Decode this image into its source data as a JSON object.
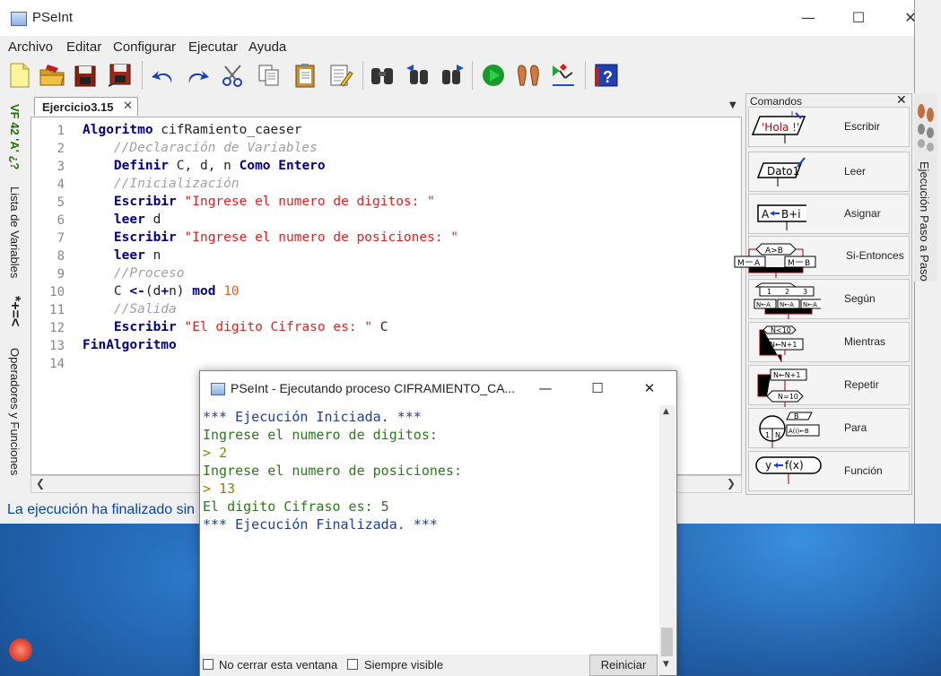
{
  "main_window": {
    "title": "PSeInt",
    "controls": {
      "minimize": "—",
      "maximize": "☐",
      "close": "✕"
    }
  },
  "menu": [
    "Archivo",
    "Editar",
    "Configurar",
    "Ejecutar",
    "Ayuda"
  ],
  "toolbar": [
    "new-file-icon",
    "open-folder-icon",
    "save-icon",
    "save-as-icon",
    "undo-icon",
    "redo-icon",
    "cut-icon",
    "copy-icon",
    "paste-icon",
    "edit-icon",
    "search-icon",
    "find-previous-icon",
    "find-next-icon",
    "run-icon",
    "step-by-step-icon",
    "flowchart-icon",
    "help-icon"
  ],
  "left_strip": {
    "symbols": "VF 42 'A' ¿?",
    "variables_label": "Lista de Variables",
    "operators_symbols": "*+=<",
    "operators_label": "Operadores y Funciones"
  },
  "editor": {
    "tab_label": "Ejercicio3.15",
    "tab_close": "✕",
    "tab_menu": "▼",
    "lines": [
      {
        "n": "1",
        "tokens": [
          {
            "t": "Algoritmo",
            "c": "kw"
          },
          {
            "t": " cifRamiento_caeser",
            "c": ""
          }
        ]
      },
      {
        "n": "2",
        "tokens": [
          {
            "t": "    //Declaración de Variables",
            "c": "cm"
          }
        ]
      },
      {
        "n": "3",
        "tokens": [
          {
            "t": "    ",
            "c": ""
          },
          {
            "t": "Definir",
            "c": "kw"
          },
          {
            "t": " C, d, n ",
            "c": ""
          },
          {
            "t": "Como Entero",
            "c": "kw"
          }
        ]
      },
      {
        "n": "4",
        "tokens": [
          {
            "t": "    //Inicialización",
            "c": "cm"
          }
        ]
      },
      {
        "n": "5",
        "tokens": [
          {
            "t": "    ",
            "c": ""
          },
          {
            "t": "Escribir",
            "c": "kw"
          },
          {
            "t": " ",
            "c": ""
          },
          {
            "t": "\"Ingrese el numero de digitos: \"",
            "c": "st"
          }
        ]
      },
      {
        "n": "6",
        "tokens": [
          {
            "t": "    ",
            "c": ""
          },
          {
            "t": "leer",
            "c": "kw"
          },
          {
            "t": " d",
            "c": ""
          }
        ]
      },
      {
        "n": "7",
        "tokens": [
          {
            "t": "    ",
            "c": ""
          },
          {
            "t": "Escribir",
            "c": "kw"
          },
          {
            "t": " ",
            "c": ""
          },
          {
            "t": "\"Ingrese el numero de posiciones: \"",
            "c": "st"
          }
        ]
      },
      {
        "n": "8",
        "tokens": [
          {
            "t": "    ",
            "c": ""
          },
          {
            "t": "leer",
            "c": "kw"
          },
          {
            "t": " n",
            "c": ""
          }
        ]
      },
      {
        "n": "9",
        "tokens": [
          {
            "t": "    //Proceso",
            "c": "cm"
          }
        ]
      },
      {
        "n": "10",
        "tokens": [
          {
            "t": "    C ",
            "c": ""
          },
          {
            "t": "<-",
            "c": "kw"
          },
          {
            "t": "(d",
            "c": ""
          },
          {
            "t": "+",
            "c": "kw"
          },
          {
            "t": "n) ",
            "c": ""
          },
          {
            "t": "mod",
            "c": "kw"
          },
          {
            "t": " ",
            "c": ""
          },
          {
            "t": "10",
            "c": "nm"
          }
        ]
      },
      {
        "n": "11",
        "tokens": [
          {
            "t": "    //Salida",
            "c": "cm"
          }
        ]
      },
      {
        "n": "12",
        "tokens": [
          {
            "t": "    ",
            "c": ""
          },
          {
            "t": "Escribir",
            "c": "kw"
          },
          {
            "t": " ",
            "c": ""
          },
          {
            "t": "\"El digito Cifraso es: \"",
            "c": "st"
          },
          {
            "t": " C",
            "c": ""
          }
        ]
      },
      {
        "n": "13",
        "tokens": [
          {
            "t": "FinAlgoritmo",
            "c": "kw"
          }
        ]
      },
      {
        "n": "14",
        "tokens": []
      }
    ]
  },
  "status": "La ejecución ha finalizado sin errores.",
  "commands": {
    "title": "Comandos",
    "close": "✕",
    "items": [
      {
        "label": "Escribir",
        "icon": "'Hola !'"
      },
      {
        "label": "Leer",
        "icon": "Dato1"
      },
      {
        "label": "Asignar",
        "icon": "A←B+i"
      },
      {
        "label": "Si-Entonces",
        "icon": "A>B"
      },
      {
        "label": "Según",
        "icon": "switch"
      },
      {
        "label": "Mientras",
        "icon": "N<10"
      },
      {
        "label": "Repetir",
        "icon": "N=10"
      },
      {
        "label": "Para",
        "icon": "for"
      },
      {
        "label": "Función",
        "icon": "y←f(x)"
      }
    ]
  },
  "step_panel_label": "Ejecución Paso a Paso",
  "run_window": {
    "title": "PSeInt - Ejecutando proceso CIFRAMIENTO_CA...",
    "controls": {
      "minimize": "—",
      "maximize": "☐",
      "close": "✕"
    },
    "console": [
      {
        "text": "*** Ejecución Iniciada. ***",
        "style": "cl-blue"
      },
      {
        "text": "Ingrese el numero de digitos:",
        "style": "cl-green"
      },
      {
        "text": "> ",
        "user": "2"
      },
      {
        "text": "Ingrese el numero de posiciones:",
        "style": "cl-green"
      },
      {
        "text": "> ",
        "user": "13"
      },
      {
        "text": "El digito Cifraso es: 5",
        "style": "cl-green"
      },
      {
        "text": "*** Ejecución Finalizada. ***",
        "style": "cl-blue"
      }
    ],
    "keep_open_label": "No cerrar esta ventana",
    "always_visible_label": "Siempre visible",
    "restart_label": "Reiniciar"
  }
}
